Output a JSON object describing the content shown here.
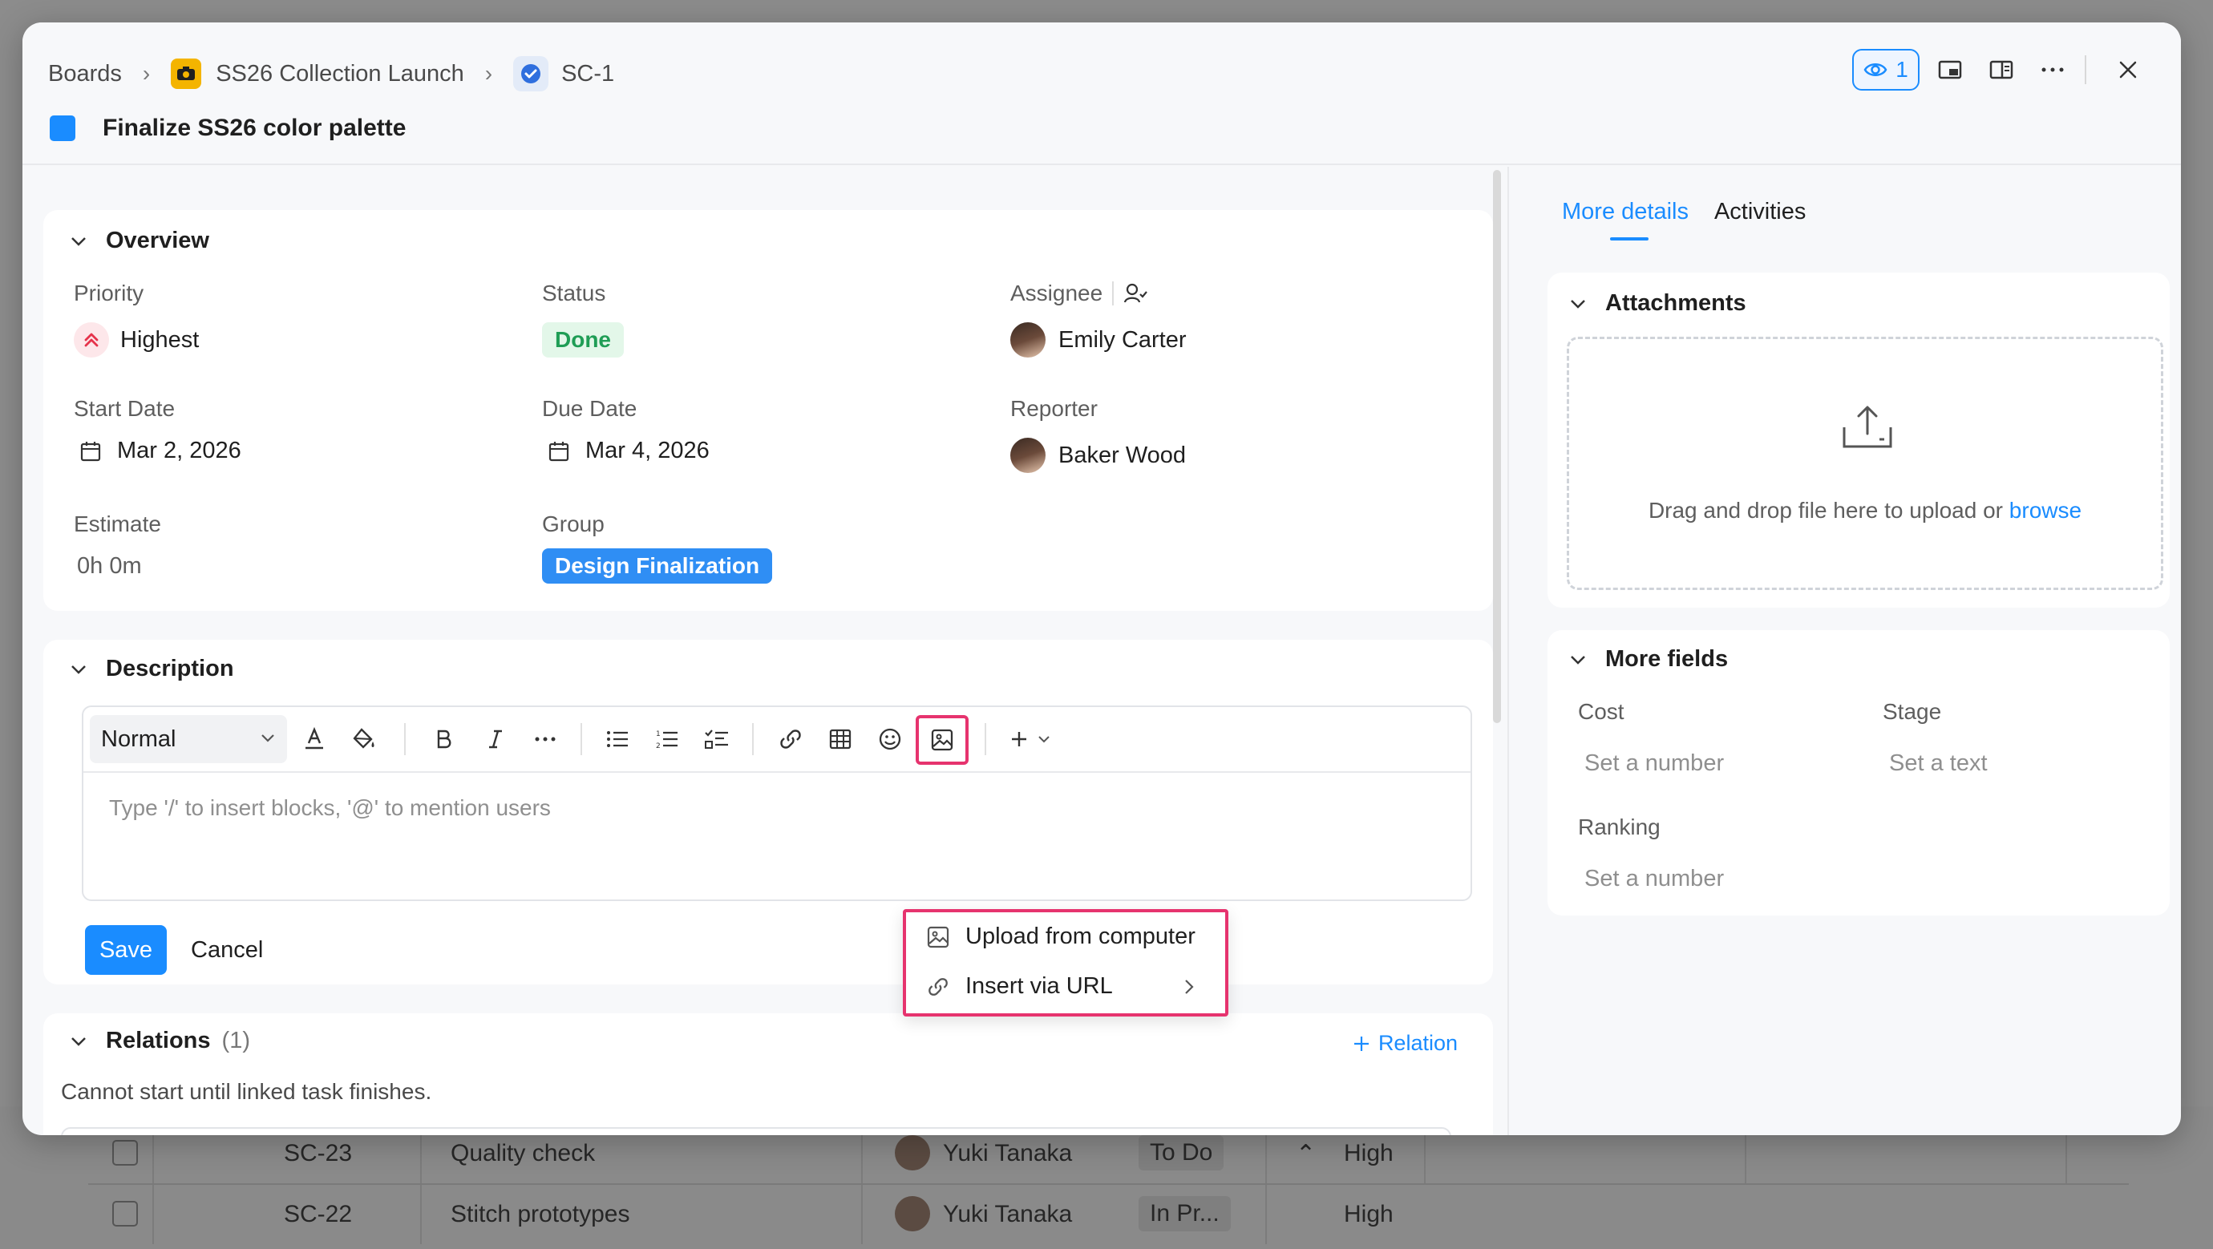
{
  "breadcrumb": {
    "root": "Boards",
    "project": "SS26 Collection Launch",
    "task_id": "SC-1"
  },
  "task": {
    "title": "Finalize SS26 color palette",
    "color": "#1a8cff"
  },
  "header_tools": {
    "watchers": "1"
  },
  "overview": {
    "title": "Overview",
    "priority": {
      "label": "Priority",
      "value": "Highest"
    },
    "status": {
      "label": "Status",
      "value": "Done"
    },
    "assignee": {
      "label": "Assignee",
      "value": "Emily Carter"
    },
    "start_date": {
      "label": "Start Date",
      "value": "Mar 2, 2026"
    },
    "due_date": {
      "label": "Due Date",
      "value": "Mar 4, 2026"
    },
    "reporter": {
      "label": "Reporter",
      "value": "Baker Wood"
    },
    "estimate": {
      "label": "Estimate",
      "value": "0h 0m"
    },
    "group": {
      "label": "Group",
      "value": "Design Finalization"
    }
  },
  "description": {
    "title": "Description",
    "text_style": "Normal",
    "placeholder": "Type '/' to insert blocks, '@' to mention users",
    "save": "Save",
    "cancel": "Cancel"
  },
  "image_menu": {
    "upload": "Upload from computer",
    "url": "Insert via URL"
  },
  "relations": {
    "title": "Relations",
    "count": "(1)",
    "add": "Relation",
    "note": "Cannot start until linked task finishes."
  },
  "right_panel": {
    "tabs": [
      "More details",
      "Activities"
    ],
    "attachments": {
      "title": "Attachments",
      "drop_text": "Drag and drop file here to upload or",
      "browse": "browse"
    },
    "more_fields": {
      "title": "More fields",
      "cost": {
        "label": "Cost",
        "value": "Set a number"
      },
      "stage": {
        "label": "Stage",
        "value": "Set a text"
      },
      "ranking": {
        "label": "Ranking",
        "value": "Set a number"
      }
    }
  },
  "background_rows": [
    {
      "id": "SC-23",
      "name": "Quality check",
      "assignee": "Yuki Tanaka",
      "status": "To Do",
      "priority": "High"
    },
    {
      "id": "SC-22",
      "name": "Stitch prototypes",
      "assignee": "Yuki Tanaka",
      "status": "In Pr...",
      "priority": "High"
    }
  ],
  "colors": {
    "accent": "#1a8cff",
    "highlight": "#e6336e",
    "done_green": "#1f9d55"
  }
}
